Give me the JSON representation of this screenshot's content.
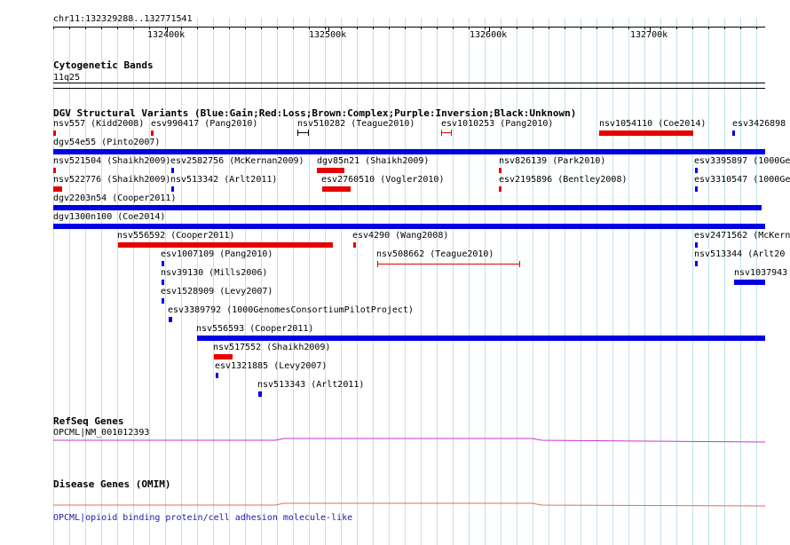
{
  "header": {
    "region": "chr11:132329288..132771541"
  },
  "ruler": {
    "ticks": [
      {
        "label": "132400k",
        "pos": 132400000
      },
      {
        "label": "132500k",
        "pos": 132500000
      },
      {
        "label": "132600k",
        "pos": 132600000
      },
      {
        "label": "132700k",
        "pos": 132700000
      }
    ]
  },
  "tracks": {
    "cytoband": {
      "title": "Cytogenetic Bands",
      "band": "11q25"
    },
    "dgv": {
      "title": "DGV Structural Variants (Blue:Gain;Red:Loss;Brown:Complex;Purple:Inversion;Black:Unknown)"
    },
    "refseq": {
      "title": "RefSeq Genes",
      "gene": "OPCML|NM_001012393"
    },
    "omim": {
      "title": "Disease Genes (OMIM)",
      "gene": "OPCML|opioid binding protein/cell adhesion molecule-like"
    }
  },
  "variants": [
    {
      "label": "nsv557 (Kidd2008)",
      "type": "loss"
    },
    {
      "label": "esv990417 (Pang2010)",
      "type": "loss"
    },
    {
      "label": "nsv510282 (Teague2010)",
      "type": "unknown"
    },
    {
      "label": "esv1010253 (Pang2010)",
      "type": "loss"
    },
    {
      "label": "nsv1054110 (Coe2014)",
      "type": "loss"
    },
    {
      "label": "esv3426898",
      "type": "gain"
    },
    {
      "label": "dgv54e55 (Pinto2007)",
      "type": "gain"
    },
    {
      "label": "nsv521504 (Shaikh2009)",
      "type": "loss"
    },
    {
      "label": "esv2582756 (McKernan2009)",
      "type": "gain"
    },
    {
      "label": "dgv85n21 (Shaikh2009)",
      "type": "loss"
    },
    {
      "label": "nsv826139 (Park2010)",
      "type": "loss"
    },
    {
      "label": "esv3395897 (1000Ge",
      "type": "gain"
    },
    {
      "label": "nsv522776 (Shaikh2009)",
      "type": "loss"
    },
    {
      "label": "nsv513342 (Arlt2011)",
      "type": "gain"
    },
    {
      "label": "esv2760510 (Vogler2010)",
      "type": "loss"
    },
    {
      "label": "esv2195896 (Bentley2008)",
      "type": "loss"
    },
    {
      "label": "esv3310547 (1000Ge",
      "type": "gain"
    },
    {
      "label": "dgv2203n54 (Cooper2011)",
      "type": "gain"
    },
    {
      "label": "dgv1300n100 (Coe2014)",
      "type": "gain"
    },
    {
      "label": "nsv556592 (Cooper2011)",
      "type": "loss"
    },
    {
      "label": "esv4290 (Wang2008)",
      "type": "loss"
    },
    {
      "label": "esv2471562 (McKern",
      "type": "gain"
    },
    {
      "label": "esv1007109 (Pang2010)",
      "type": "gain"
    },
    {
      "label": "nsv508662 (Teague2010)",
      "type": "loss"
    },
    {
      "label": "nsv513344 (Arlt20",
      "type": "gain"
    },
    {
      "label": "nsv39130 (Mills2006)",
      "type": "gain"
    },
    {
      "label": "nsv1037943",
      "type": "gain"
    },
    {
      "label": "esv1528909 (Levy2007)",
      "type": "gain"
    },
    {
      "label": "esv3389792 (1000GenomesConsortiumPilotProject)",
      "type": "gain"
    },
    {
      "label": "nsv556593 (Cooper2011)",
      "type": "gain"
    },
    {
      "label": "nsv517552 (Shaikh2009)",
      "type": "loss"
    },
    {
      "label": "esv1321885 (Levy2007)",
      "type": "gain"
    },
    {
      "label": "nsv513343 (Arlt2011)",
      "type": "gain"
    }
  ],
  "colors": {
    "gain": "#0000e6",
    "loss": "#e60000",
    "unknown": "#000000",
    "grid": "#bfe3ef",
    "refseq_line": "#cc33cc",
    "omim_line": "#e07050",
    "omim_text": "#1a1aa6"
  }
}
